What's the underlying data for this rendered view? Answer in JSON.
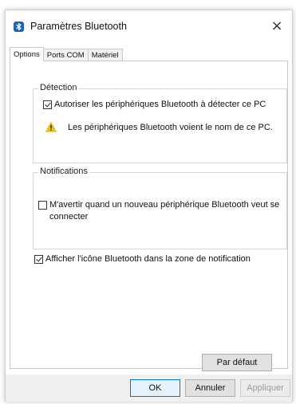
{
  "window": {
    "title": "Paramètres Bluetooth",
    "close_glyph": "×",
    "title_icon": "bluetooth-icon"
  },
  "tabs": [
    {
      "label": "Options",
      "active": true
    },
    {
      "label": "Ports COM",
      "active": false
    },
    {
      "label": "Matériel",
      "active": false
    }
  ],
  "detection": {
    "legend": "Détection",
    "allow_discovery": {
      "label": "Autoriser les périphériques Bluetooth à détecter ce PC",
      "checked": true
    },
    "warning": {
      "icon": "warning-icon",
      "text": "Les périphériques Bluetooth voient le nom de ce PC."
    }
  },
  "notifications": {
    "legend": "Notifications",
    "alert_new_device": {
      "label": "M'avertir quand un nouveau périphérique Bluetooth veut se connecter",
      "checked": false
    }
  },
  "show_tray_icon": {
    "label": "Afficher l'icône Bluetooth dans la zone de notification",
    "checked": true
  },
  "buttons": {
    "restore_defaults": "Par défaut",
    "ok": "OK",
    "cancel": "Annuler",
    "apply": "Appliquer"
  },
  "colors": {
    "accent": "#0078d7",
    "warning": "#f4c20d",
    "bluetooth": "#1565c0"
  }
}
